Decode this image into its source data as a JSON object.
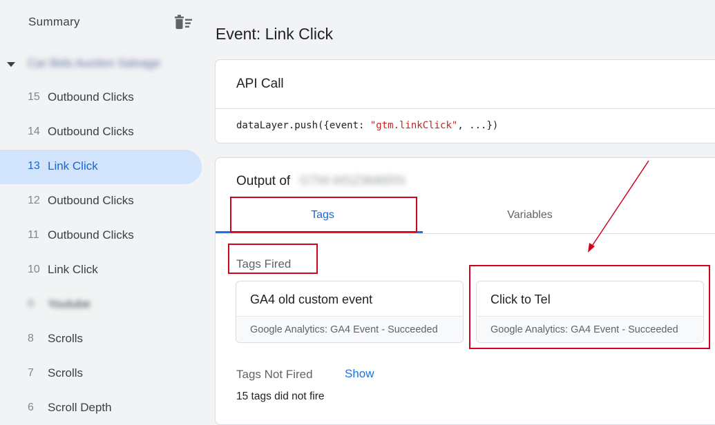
{
  "sidebar": {
    "summary_label": "Summary",
    "container_name": "Car Bids Auction Salvage",
    "events": [
      {
        "num": "15",
        "label": "Outbound Clicks",
        "active": false,
        "blurred": false
      },
      {
        "num": "14",
        "label": "Outbound Clicks",
        "active": false,
        "blurred": false
      },
      {
        "num": "13",
        "label": "Link Click",
        "active": true,
        "blurred": false
      },
      {
        "num": "12",
        "label": "Outbound Clicks",
        "active": false,
        "blurred": false
      },
      {
        "num": "11",
        "label": "Outbound Clicks",
        "active": false,
        "blurred": false
      },
      {
        "num": "10",
        "label": "Link Click",
        "active": false,
        "blurred": false
      },
      {
        "num": "9",
        "label": "Youtube",
        "active": false,
        "blurred": true
      },
      {
        "num": "8",
        "label": "Scrolls",
        "active": false,
        "blurred": false
      },
      {
        "num": "7",
        "label": "Scrolls",
        "active": false,
        "blurred": false
      },
      {
        "num": "6",
        "label": "Scroll Depth",
        "active": false,
        "blurred": false
      }
    ]
  },
  "main": {
    "title": "Event: Link Click",
    "api_call": {
      "heading": "API Call",
      "code_prefix": "dataLayer.push({event: ",
      "code_string": "\"gtm.linkClick\"",
      "code_suffix": ", ...})"
    },
    "output": {
      "title_prefix": "Output of",
      "container_id": "GTM-MSZ9M6RN",
      "tabs": [
        {
          "label": "Tags",
          "active": true
        },
        {
          "label": "Variables",
          "active": false
        }
      ],
      "tags_fired_label": "Tags Fired",
      "fired_tags": [
        {
          "name": "GA4 old custom event",
          "subtitle": "Google Analytics: GA4 Event - Succeeded"
        },
        {
          "name": "Click to Tel",
          "subtitle": "Google Analytics: GA4 Event - Succeeded"
        }
      ],
      "tags_not_fired_label": "Tags Not Fired",
      "show_label": "Show",
      "not_fired_summary": "15 tags did not fire"
    }
  },
  "colors": {
    "accent": "#1a73e8",
    "active_item_bg": "#d2e3fc",
    "annotation": "#d0021b"
  }
}
